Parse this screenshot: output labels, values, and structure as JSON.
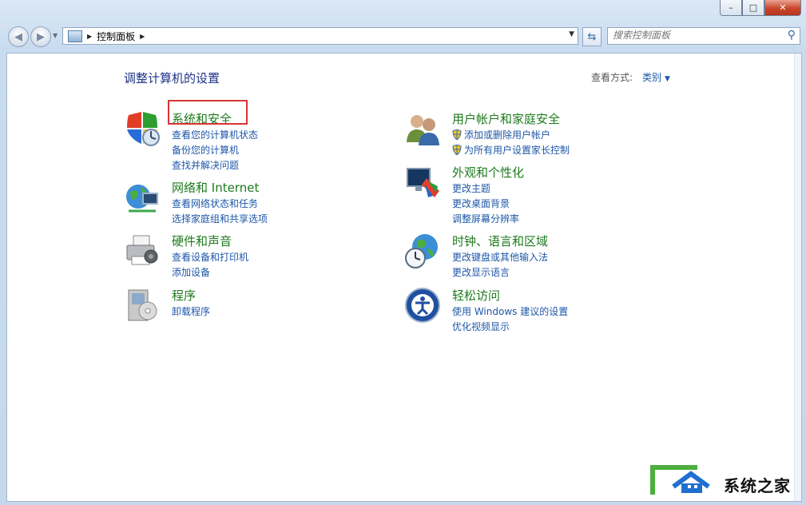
{
  "window": {
    "buttons": {
      "minimize": "–",
      "maximize": "□",
      "close": "✕"
    }
  },
  "nav": {
    "back_icon": "back-arrow-icon",
    "forward_icon": "forward-arrow-icon",
    "breadcrumb": "控制面板",
    "search_placeholder": "搜索控制面板"
  },
  "main": {
    "heading": "调整计算机的设置",
    "view_by_label": "查看方式:",
    "view_by_value": "类别",
    "categories": [
      {
        "title": "系统和安全",
        "icon": "shield-security-icon",
        "links": [
          "查看您的计算机状态",
          "备份您的计算机",
          "查找并解决问题"
        ]
      },
      {
        "title": "网络和 Internet",
        "icon": "network-globe-icon",
        "links": [
          "查看网络状态和任务",
          "选择家庭组和共享选项"
        ]
      },
      {
        "title": "硬件和声音",
        "icon": "printer-speaker-icon",
        "links": [
          "查看设备和打印机",
          "添加设备"
        ]
      },
      {
        "title": "程序",
        "icon": "programs-disc-icon",
        "links": [
          "卸载程序"
        ]
      },
      {
        "title": "用户帐户和家庭安全",
        "icon": "users-icon",
        "links": [
          "添加或删除用户帐户",
          "为所有用户设置家长控制"
        ]
      },
      {
        "title": "外观和个性化",
        "icon": "monitor-palette-icon",
        "links": [
          "更改主题",
          "更改桌面背景",
          "调整屏幕分辨率"
        ]
      },
      {
        "title": "时钟、语言和区域",
        "icon": "globe-clock-icon",
        "links": [
          "更改键盘或其他输入法",
          "更改显示语言"
        ]
      },
      {
        "title": "轻松访问",
        "icon": "ease-of-access-icon",
        "links": [
          "使用 Windows 建议的设置",
          "优化视频显示"
        ]
      }
    ]
  },
  "watermark": {
    "text": "系统之家"
  },
  "colors": {
    "category_title": "#1d7a1d",
    "link": "#1e57a8",
    "heading": "#1e3287",
    "highlight": "#d93434"
  }
}
